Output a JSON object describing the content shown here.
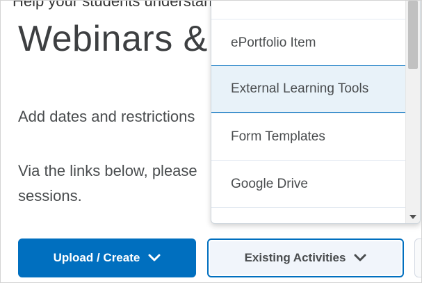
{
  "top_cutoff_text": "Help your students understand",
  "page": {
    "title": "Webinars &",
    "paragraph1": "Add dates and restrictions",
    "paragraph2_line1": "Via the links below, please",
    "paragraph2_line2": "sessions."
  },
  "buttons": {
    "upload_create": "Upload / Create",
    "existing_activities": "Existing Activities"
  },
  "menu": {
    "items": [
      {
        "label": "ePortfolio Item"
      },
      {
        "label": "External Learning Tools",
        "active": true
      },
      {
        "label": "Form Templates"
      },
      {
        "label": "Google Drive"
      },
      {
        "label": ""
      }
    ]
  },
  "colors": {
    "primary": "#006fbf",
    "menu_active_bg": "#e8f2f9",
    "secondary_bg": "#f1f5fb"
  }
}
